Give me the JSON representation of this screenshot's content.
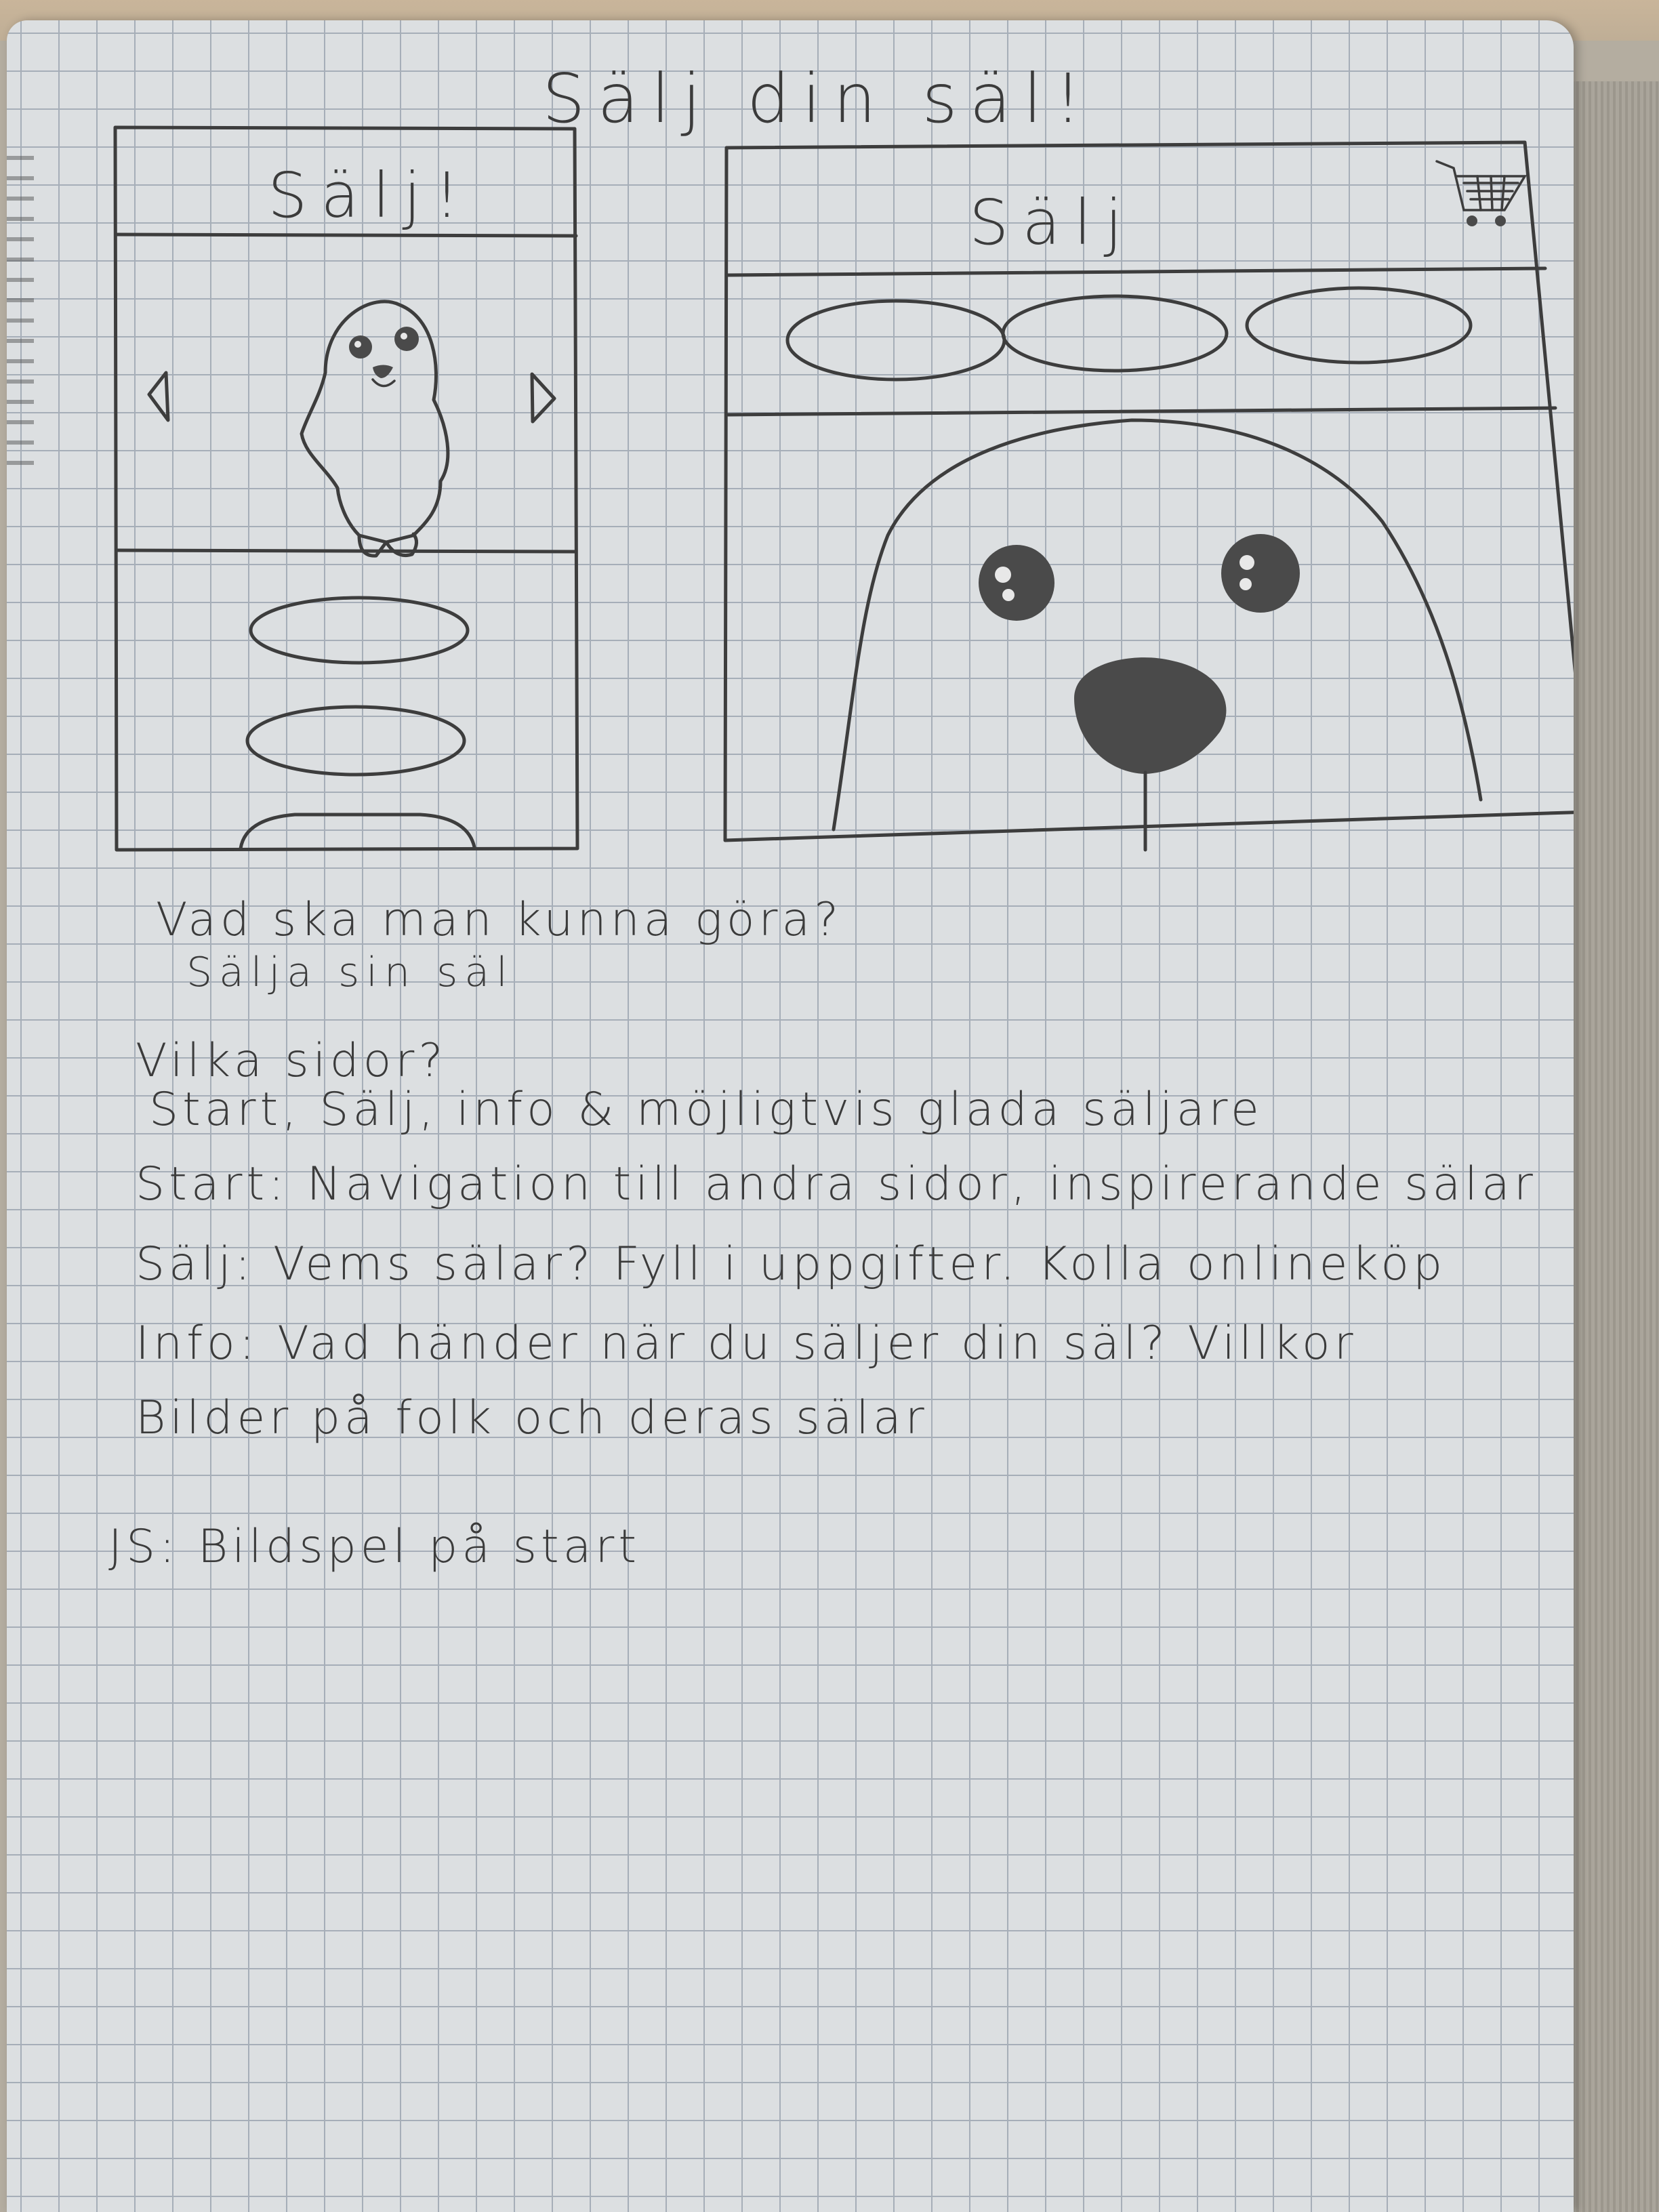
{
  "page": {
    "title": "Sälj din säl!"
  },
  "mobile_screen": {
    "header": "Sälj!",
    "prev_arrow": "left-arrow",
    "next_arrow": "right-arrow",
    "buttons": 3
  },
  "desktop_screen": {
    "header": "Sälj",
    "cart_icon": "cart-icon",
    "nav_buttons": 3
  },
  "notes": [
    "Vad ska man kunna göra?",
    "Sälja sin säl",
    "Vilka sidor?",
    "Start, Sälj, info & möjligtvis glada säljare",
    "Start: Navigation till andra sidor, inspirerande sälar",
    "Sälj: Vems sälar? Fyll i uppgifter. Kolla onlineköp",
    "Info: Vad händer när du säljer din säl? Villkor",
    "Bilder på folk och deras sälar",
    "JS: Bildspel på start"
  ],
  "colors": {
    "paper": "#dcdfe1",
    "grid": "#a6aeb8",
    "pencil": "#3d3d3d"
  }
}
